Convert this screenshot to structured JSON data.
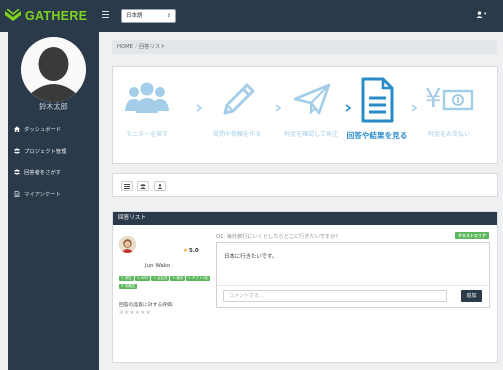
{
  "brand": {
    "name": "GATHERE"
  },
  "header": {
    "language": "日本語"
  },
  "sidebar": {
    "user_name": "鈴木太郎",
    "items": [
      {
        "label": "ダッシュボード",
        "icon": "home-icon"
      },
      {
        "label": "プロジェクト管理",
        "icon": "users-icon"
      },
      {
        "label": "回答者をさがす",
        "icon": "users-icon"
      },
      {
        "label": "マイアンケート",
        "icon": "document-icon"
      }
    ]
  },
  "breadcrumb": {
    "home": "HOME",
    "separator": "/",
    "current": "回答リスト"
  },
  "steps": [
    {
      "label": "モニターを探す",
      "icon": "people-icon"
    },
    {
      "label": "質問や依頼を作る",
      "icon": "pencil-icon"
    },
    {
      "label": "料金を確認して発注",
      "icon": "paper-plane-icon"
    },
    {
      "label": "回答や結果を見る",
      "icon": "document-icon",
      "active": true
    },
    {
      "label": "料金をお支払い",
      "icon": "yen-bill-icon"
    }
  ],
  "answers": {
    "title": "回答リスト",
    "respondent": {
      "name": "Jun Wako",
      "rating": "5.0",
      "tags": [
        "✎ 男性",
        "✎ 40代",
        "✎ 会社員",
        "✎ 東京",
        "✎ ギフト1倍",
        "✎ 未婚性"
      ]
    },
    "evaluation_label": "回答の品質に対する評価:",
    "evaluation_stars": "⊗★★★★★",
    "question": "Q1. 海外旅行にいくとしたらどこに行きたいですか？",
    "question_type_badge": "テキストエリア",
    "answer_text": "日本に行きたいです。",
    "comment_placeholder": "コメントする...",
    "comment_button": "追加"
  },
  "colors": {
    "navy": "#2b3a4a",
    "brand_green": "#7ed321",
    "active_step_blue": "#2a8bc9",
    "inactive_step_blue": "#a3cde8",
    "tag_green": "#5cb85c"
  }
}
